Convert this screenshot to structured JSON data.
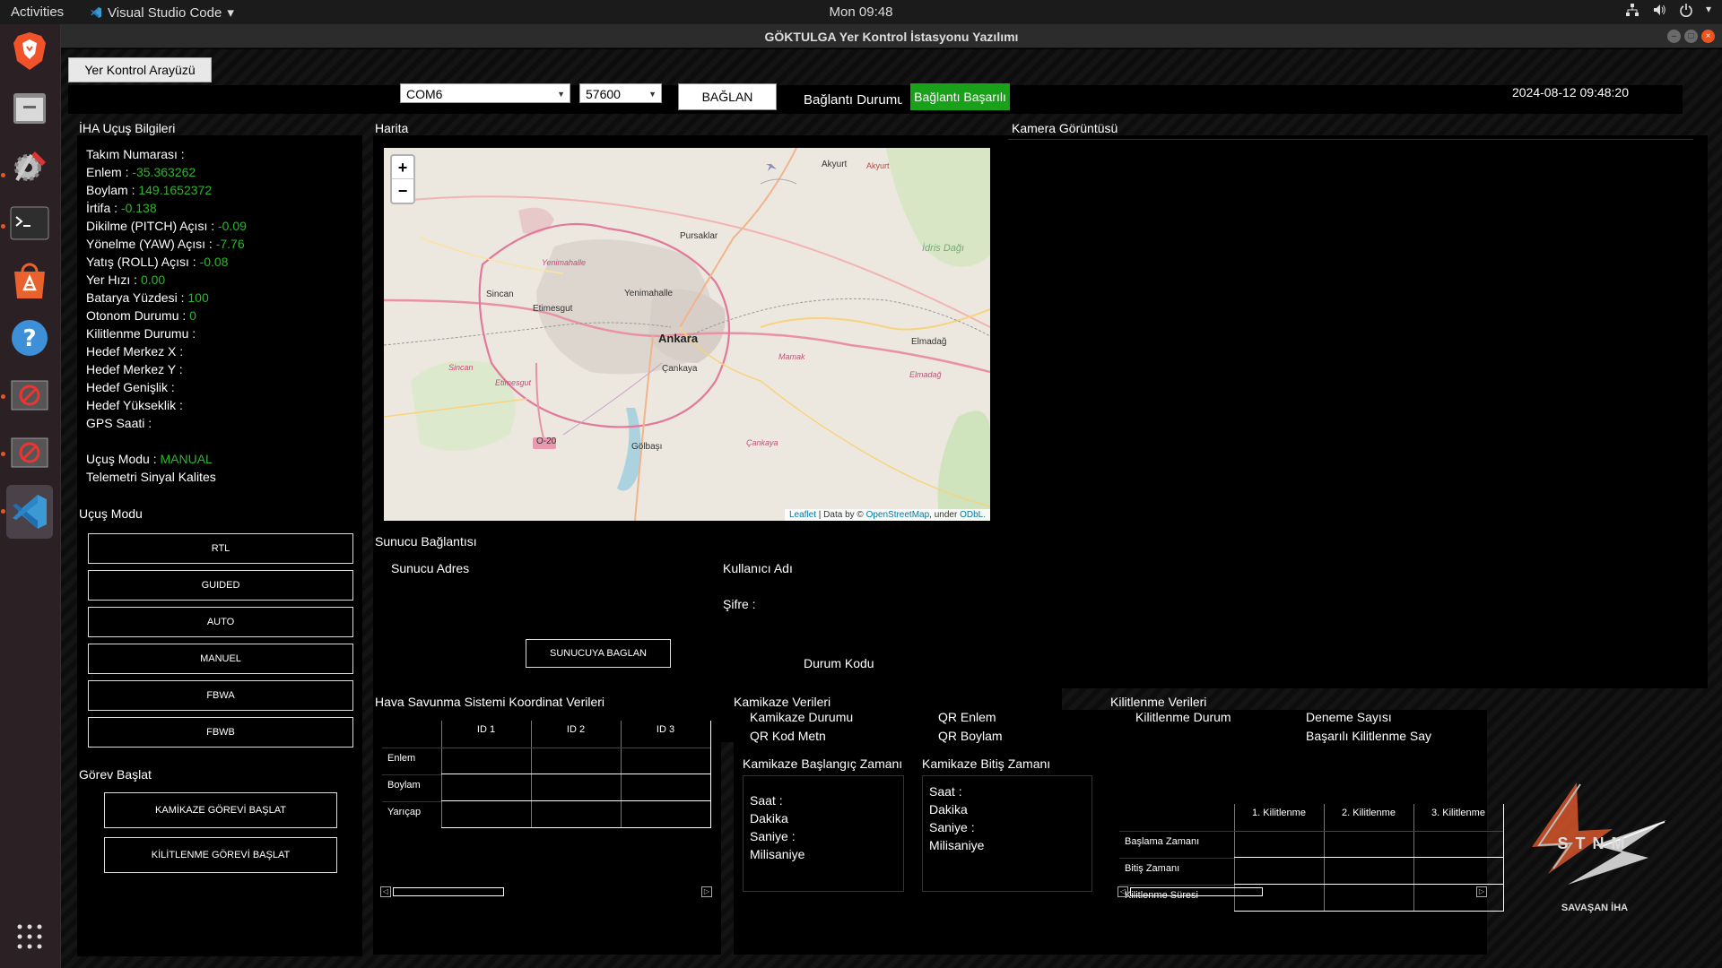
{
  "topbar": {
    "activities": "Activities",
    "app_name": "Visual Studio Code",
    "app_menu_arrow": "▾",
    "clock": "Mon 09:48",
    "tray_icons": [
      "network-icon",
      "volume-icon",
      "power-icon"
    ]
  },
  "dock": {
    "items": [
      "brave-browser-icon",
      "files-icon",
      "settings-tool-icon",
      "terminal-icon",
      "software-store-icon",
      "help-icon",
      "blocked-app-icon",
      "blocked-app-icon",
      "vscode-icon"
    ],
    "apps_grid_icon": "show-apps-icon"
  },
  "window": {
    "title": "GÖKTULGA Yer Kontrol İstasyonu Yazılımı"
  },
  "tab": {
    "label": "Yer Kontrol Arayüzü"
  },
  "connection": {
    "port_value": "COM6",
    "baud_value": "57600",
    "connect_button": "BAĞLAN",
    "status_label": "Bağlantı Durumu",
    "status_value": "Bağlantı Başarılı",
    "status_color": "#1aa11a",
    "datetime": "2024-08-12 09:48:20"
  },
  "flight_info": {
    "title": "İHA Uçuş Bilgileri",
    "rows": [
      {
        "label": "Takım Numarası :",
        "value": ""
      },
      {
        "label": "Enlem :",
        "value": "-35.363262"
      },
      {
        "label": "Boylam :",
        "value": "149.1652372"
      },
      {
        "label": "İrtifa :",
        "value": "-0.138"
      },
      {
        "label": "Dikilme (PITCH) Açısı :",
        "value": "-0.09"
      },
      {
        "label": "Yönelme (YAW) Açısı :",
        "value": "-7.76"
      },
      {
        "label": "Yatış (ROLL) Açısı :",
        "value": "-0.08"
      },
      {
        "label": "Yer Hızı :",
        "value": "0.00"
      },
      {
        "label": "Batarya Yüzdesi :",
        "value": "100"
      },
      {
        "label": "Otonom Durumu :",
        "value": "0"
      },
      {
        "label": "Kilitlenme Durumu :",
        "value": ""
      },
      {
        "label": "Hedef Merkez X :",
        "value": ""
      },
      {
        "label": "Hedef Merkez Y :",
        "value": ""
      },
      {
        "label": "Hedef Genişlik :",
        "value": ""
      },
      {
        "label": "Hedef Yükseklik :",
        "value": ""
      },
      {
        "label": "GPS Saati :",
        "value": ""
      }
    ],
    "mode_label": "Uçuş Modu :",
    "mode_value": "MANUAL",
    "telemetry_label": "Telemetri Sinyal Kalites"
  },
  "flight_modes": {
    "title": "Uçuş Modu",
    "buttons": [
      "RTL",
      "GUIDED",
      "AUTO",
      "MANUEL",
      "FBWA",
      "FBWB"
    ]
  },
  "mission": {
    "title": "Görev Başlat",
    "kamikaze_button": "KAMİKAZE GÖREVİ BAŞLAT",
    "lock_button": "KİLİTLENME GÖREVİ BAŞLAT"
  },
  "map": {
    "title": "Harita",
    "zoom_in": "+",
    "zoom_out": "−",
    "labels": [
      "Akyurt",
      "Akyurt",
      "Pursaklar",
      "İdris Dağı",
      "Yenimahalle",
      "Yenimahalle",
      "Sincan",
      "Etimesgut",
      "Ankara",
      "Mamak",
      "Elmadağ",
      "Elmadağ",
      "Sincan",
      "Çankaya",
      "Etimesgut",
      "O-20",
      "Gölbaşı",
      "Çankaya"
    ],
    "attribution_leaflet": "Leaflet",
    "attribution_mid": " | Data by © ",
    "attribution_osm": "OpenStreetMap",
    "attribution_under": ", under ",
    "attribution_odbl": "ODbL."
  },
  "camera": {
    "title": "Kamera Görüntüsü"
  },
  "server": {
    "title": "Sunucu Bağlantısı",
    "address_label": "Sunucu Adres",
    "username_label": "Kullanıcı Adı",
    "password_label": "Şifre :",
    "connect_button": "SUNUCUYA BAGLAN",
    "status_code_label": "Durum Kodu"
  },
  "air_defense": {
    "title": "Hava Savunma Sistemi Koordinat Verileri",
    "columns": [
      "ID 1",
      "ID 2",
      "ID 3"
    ],
    "rows": [
      "Enlem",
      "Boylam",
      "Yarıçap"
    ]
  },
  "kamikaze": {
    "title": "Kamikaze Verileri",
    "status_label": "Kamikaze Durumu",
    "qr_text_label": "QR Kod Metn",
    "qr_lat_label": "QR Enlem",
    "qr_lon_label": "QR Boylam",
    "start_title": "Kamikaze Başlangıç Zamanı",
    "end_title": "Kamikaze Bitiş Zamanı",
    "time_fields": [
      "Saat :",
      "Dakika",
      "Saniye :",
      "Milisaniye"
    ]
  },
  "lock": {
    "title": "Kilitlenme Verileri",
    "status_label": "Kilitlenme Durum",
    "attempts_label": "Deneme Sayısı",
    "success_label": "Başarılı Kilitlenme Say",
    "columns": [
      "1. Kilitlenme",
      "2. Kilitlenme",
      "3. Kilitlenme"
    ],
    "rows": [
      "Başlama Zamanı",
      "Bitiş Zamanı",
      "Kilitlenme Süresi"
    ]
  },
  "logo": {
    "text": "STNM",
    "caption": "SAVAŞAN İHA"
  }
}
